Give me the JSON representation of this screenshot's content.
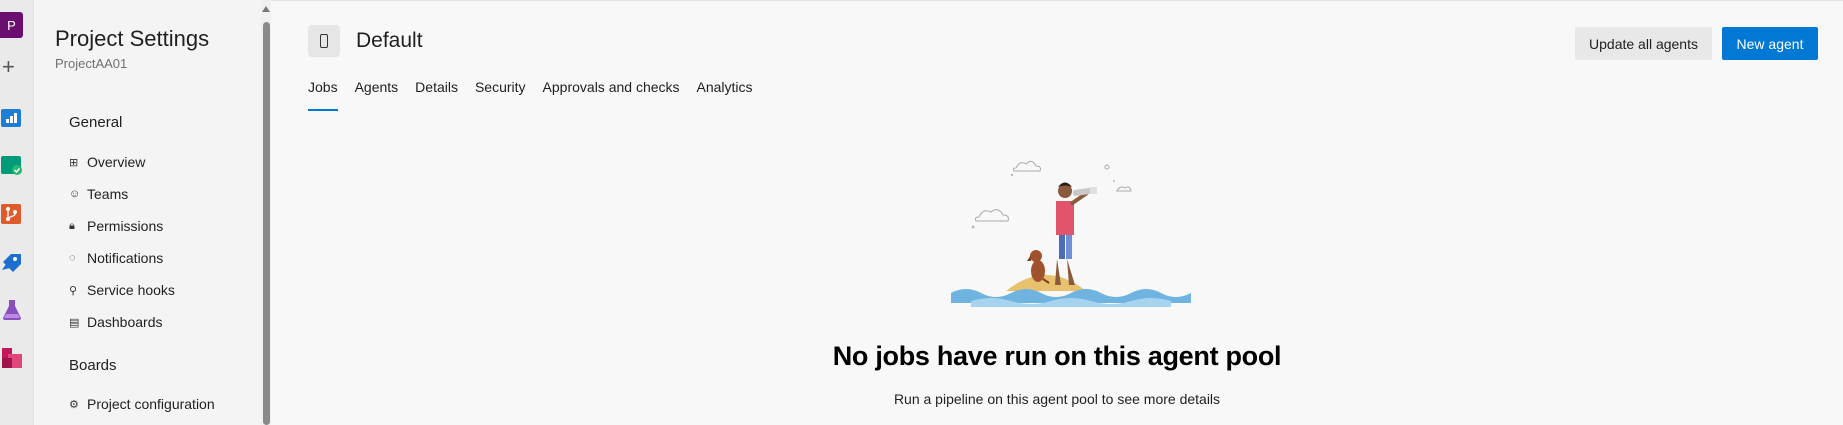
{
  "rail": {
    "avatar_letter": "P",
    "plus": "+",
    "icons": [
      "overview-icon",
      "boards-icon",
      "repos-icon",
      "pipelines-icon",
      "test-plans-icon",
      "artifacts-icon"
    ],
    "colors": [
      "#1c7ed6",
      "#009c7a",
      "#e05a2b",
      "#1c6ecf",
      "#8a4fbf",
      "#c2185b"
    ]
  },
  "nav": {
    "title": "Project Settings",
    "subtitle": "ProjectAA01",
    "general_heading": "General",
    "general_items": [
      {
        "label": "Overview",
        "icon": "overview-grid-icon"
      },
      {
        "label": "Teams",
        "icon": "teams-icon"
      },
      {
        "label": "Permissions",
        "icon": "lock-icon"
      },
      {
        "label": "Notifications",
        "icon": "chat-icon"
      },
      {
        "label": "Service hooks",
        "icon": "hook-icon"
      },
      {
        "label": "Dashboards",
        "icon": "dashboard-icon"
      }
    ],
    "boards_heading": "Boards",
    "boards_items": [
      {
        "label": "Project configuration",
        "icon": "config-icon"
      }
    ]
  },
  "header": {
    "pool_name": "Default",
    "update_button": "Update all agents",
    "new_button": "New agent"
  },
  "tabs": [
    "Jobs",
    "Agents",
    "Details",
    "Security",
    "Approvals and checks",
    "Analytics"
  ],
  "active_tab": "Jobs",
  "empty_state": {
    "title": "No jobs have run on this agent pool",
    "subtitle": "Run a pipeline on this agent pool to see more details"
  },
  "colors": {
    "accent": "#0078d4",
    "avatar": "#6b0e71"
  }
}
